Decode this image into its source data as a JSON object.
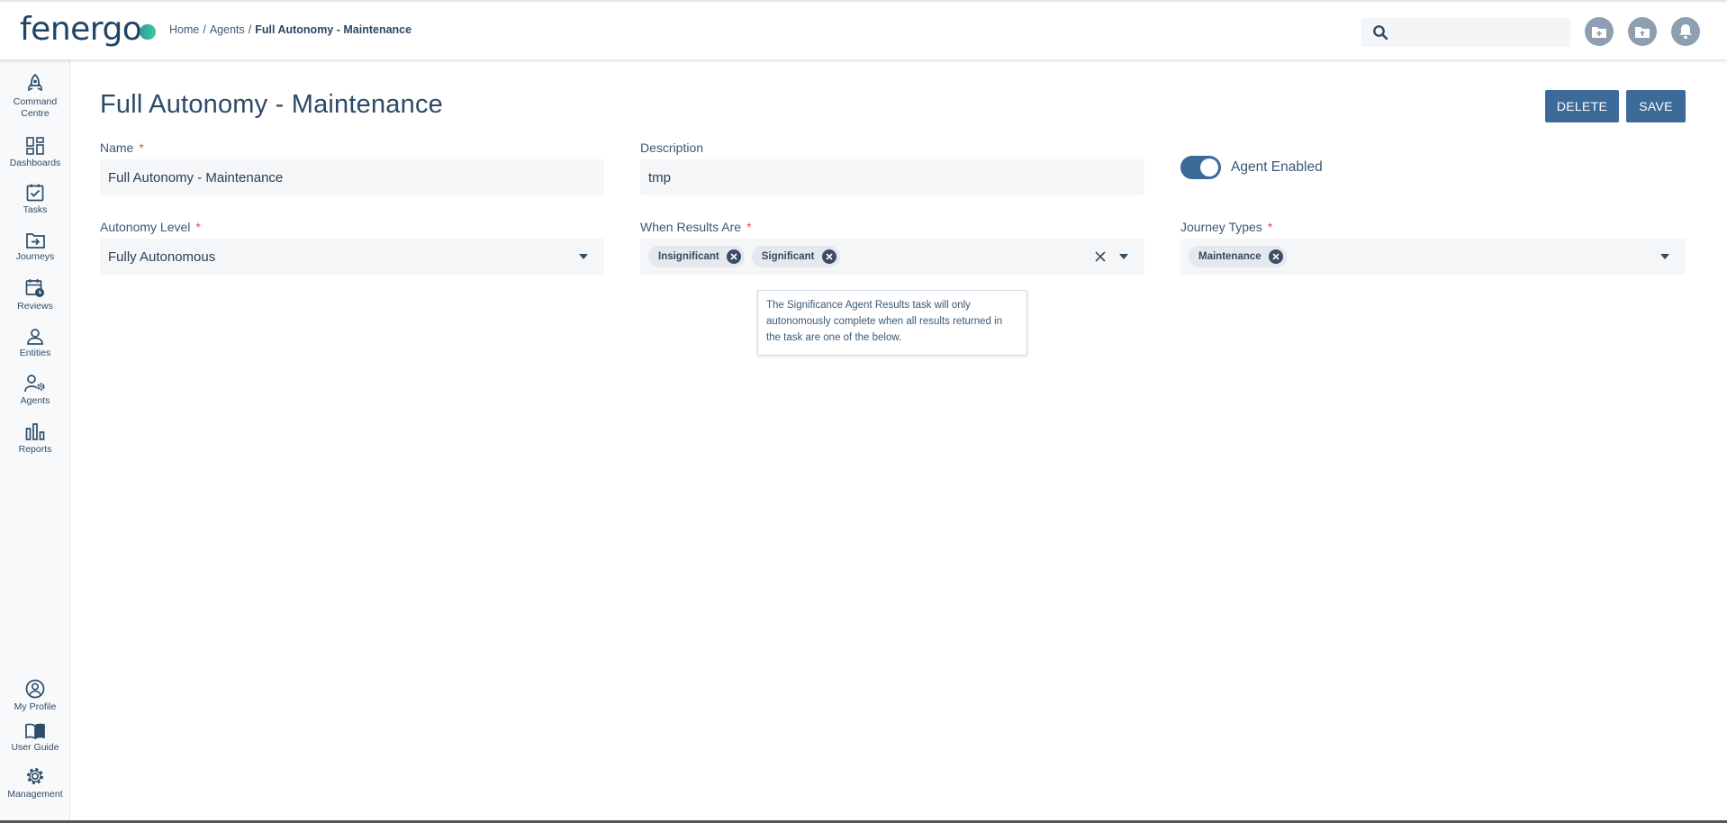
{
  "header": {
    "logo_text": "fenergo",
    "breadcrumb": {
      "home": "Home",
      "sep1": "/",
      "agents": "Agents",
      "sep2": "/",
      "current": "Full Autonomy - Maintenance"
    },
    "search": {
      "placeholder": ""
    },
    "actions": [
      "new-folder-icon",
      "upload-folder-icon",
      "bell-icon"
    ]
  },
  "sidebar": {
    "items": [
      {
        "label": "Command Centre",
        "icon": "rocket-icon"
      },
      {
        "label": "Dashboards",
        "icon": "dashboard-icon"
      },
      {
        "label": "Tasks",
        "icon": "task-check-icon"
      },
      {
        "label": "Journeys",
        "icon": "journey-icon"
      },
      {
        "label": "Reviews",
        "icon": "calendar-clock-icon"
      },
      {
        "label": "Entities",
        "icon": "person-icon"
      },
      {
        "label": "Agents",
        "icon": "agent-gear-icon"
      },
      {
        "label": "Reports",
        "icon": "bar-chart-icon"
      }
    ],
    "bottom_items": [
      {
        "label": "My Profile",
        "icon": "profile-icon"
      },
      {
        "label": "User Guide",
        "icon": "book-icon"
      },
      {
        "label": "Management",
        "icon": "gear-icon"
      }
    ]
  },
  "page": {
    "title": "Full Autonomy - Maintenance",
    "delete_label": "DELETE",
    "save_label": "SAVE"
  },
  "form": {
    "name": {
      "label": "Name",
      "required": "*",
      "value": "Full Autonomy - Maintenance"
    },
    "description": {
      "label": "Description",
      "value": "tmp"
    },
    "agent_enabled": {
      "label": "Agent Enabled",
      "on": true
    },
    "autonomy_level": {
      "label": "Autonomy Level",
      "required": "*",
      "value": "Fully Autonomous"
    },
    "when_results_are": {
      "label": "When Results Are",
      "required": "*",
      "chips": [
        "Insignificant",
        "Significant"
      ]
    },
    "journey_types": {
      "label": "Journey Types",
      "required": "*",
      "chips": [
        "Maintenance"
      ]
    }
  },
  "tooltip": {
    "text": "The Significance Agent Results task will only autonomously complete when all results returned in the task are one of the below."
  },
  "colors": {
    "primary": "#3d6b99",
    "required": "#d9534f",
    "text": "#2f4d6a"
  }
}
